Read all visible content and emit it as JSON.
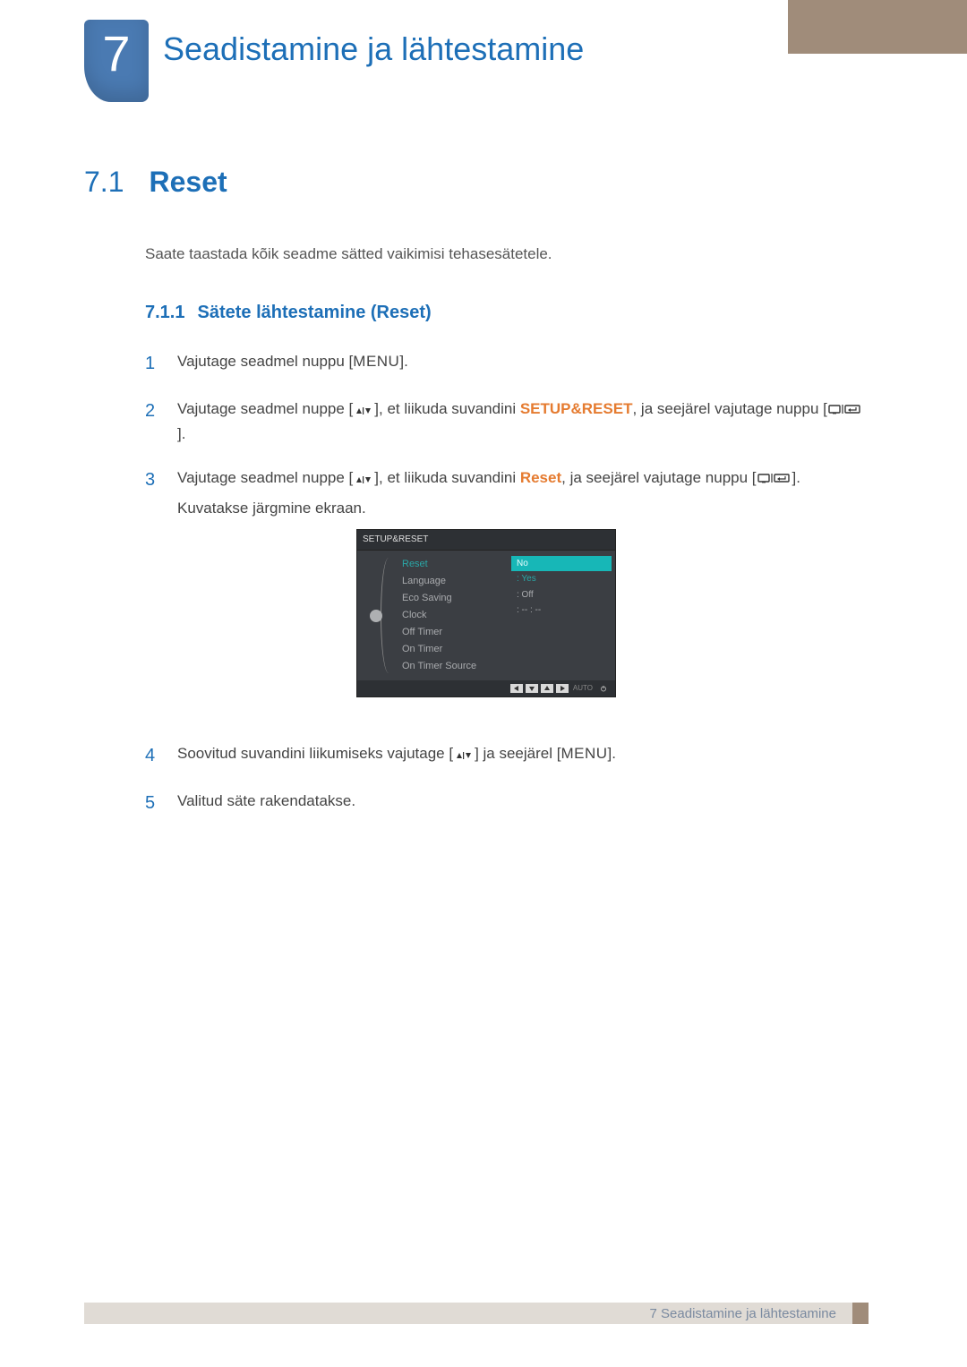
{
  "chapter": {
    "number": "7",
    "title": "Seadistamine ja lähtestamine"
  },
  "section": {
    "num": "7.1",
    "title": "Reset"
  },
  "intro": "Saate taastada kõik seadme sätted vaikimisi tehasesätetele.",
  "subsection": {
    "num": "7.1.1",
    "title": "Sätete lähtestamine (Reset)"
  },
  "steps": {
    "s1": {
      "num": "1",
      "t1": "Vajutage seadmel nuppu [",
      "menu": "MENU",
      "t2": "]."
    },
    "s2": {
      "num": "2",
      "t1": "Vajutage seadmel nuppe [",
      "t2": "], et liikuda suvandini ",
      "kw": "SETUP&RESET",
      "t3": ", ja seejärel vajutage nuppu [",
      "t4": "]."
    },
    "s3": {
      "num": "3",
      "t1": "Vajutage seadmel nuppe [",
      "t2": "], et liikuda suvandini ",
      "kw": "Reset",
      "t3": ", ja seejärel vajutage nuppu [",
      "t4": "].",
      "t5": "Kuvatakse järgmine ekraan."
    },
    "s4": {
      "num": "4",
      "t1": "Soovitud suvandini liikumiseks vajutage [",
      "t2": "] ja seejärel [",
      "menu": "MENU",
      "t3": "]."
    },
    "s5": {
      "num": "5",
      "t1": "Valitud säte rakendatakse."
    }
  },
  "osd": {
    "title": "SETUP&RESET",
    "rows": [
      {
        "label": "Reset",
        "value": "",
        "selected": true
      },
      {
        "label": "Language",
        "value": ": Yes"
      },
      {
        "label": "Eco Saving",
        "value": ": Off"
      },
      {
        "label": "Clock",
        "value": ": -- : --"
      },
      {
        "label": "Off Timer",
        "value": ""
      },
      {
        "label": "On Timer",
        "value": ""
      },
      {
        "label": "On Timer Source",
        "value": ""
      }
    ],
    "highlight": "No",
    "yes": ": Yes",
    "auto": "AUTO"
  },
  "footer": {
    "text": "7 Seadistamine ja lähtestamine"
  }
}
